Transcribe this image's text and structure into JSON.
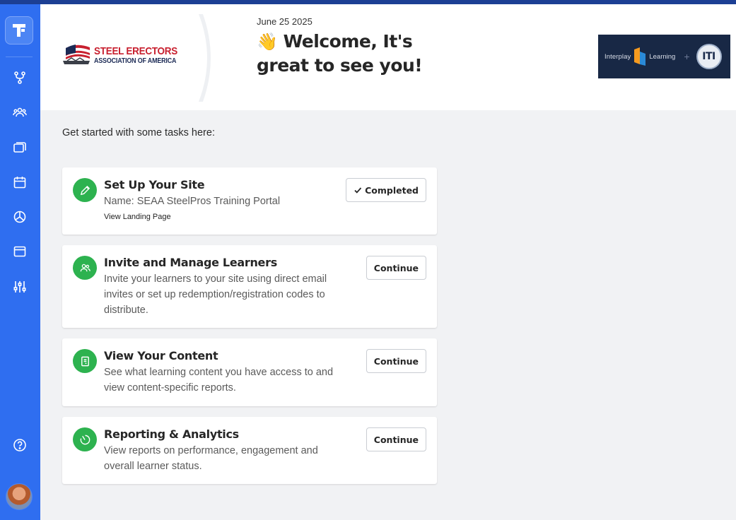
{
  "header": {
    "date": "June 25 2025",
    "welcome_emoji": "👋",
    "welcome_text": "Welcome, It's great to see you!",
    "org_logo": {
      "line1": "STEEL ERECTORS",
      "line2": "ASSOCIATION OF AMERICA"
    },
    "partner_logo": {
      "left": "Interplay",
      "middle": "Learning",
      "plus": "+",
      "right": "ITI"
    }
  },
  "sidebar": {
    "items": [
      {
        "name": "pathways",
        "icon": "branch-icon"
      },
      {
        "name": "learners",
        "icon": "users-icon"
      },
      {
        "name": "content",
        "icon": "layers-icon"
      },
      {
        "name": "calendar",
        "icon": "calendar-icon"
      },
      {
        "name": "analytics",
        "icon": "pie-chart-icon"
      },
      {
        "name": "site",
        "icon": "browser-window-icon"
      },
      {
        "name": "settings",
        "icon": "sliders-icon"
      },
      {
        "name": "help",
        "icon": "help-circle-icon"
      }
    ],
    "accent_color": "#2f6ef0"
  },
  "main": {
    "intro": "Get started with some tasks here:",
    "tasks": [
      {
        "title": "Set Up Your Site",
        "description": "Name: SEAA SteelPros Training Portal",
        "link": "View Landing Page",
        "button": "Completed",
        "icon": "pencil-icon"
      },
      {
        "title": "Invite and Manage Learners",
        "description": "Invite your learners to your site using direct email invites or set up redemption/registration codes to distribute.",
        "button": "Continue",
        "icon": "users-icon"
      },
      {
        "title": "View Your Content",
        "description": "See what learning content you have access to and view content-specific reports.",
        "button": "Continue",
        "icon": "document-icon"
      },
      {
        "title": "Reporting & Analytics",
        "description": "View reports on performance, engagement and overall learner status.",
        "button": "Continue",
        "icon": "analytics-icon"
      }
    ],
    "success_color": "#2db24f"
  }
}
